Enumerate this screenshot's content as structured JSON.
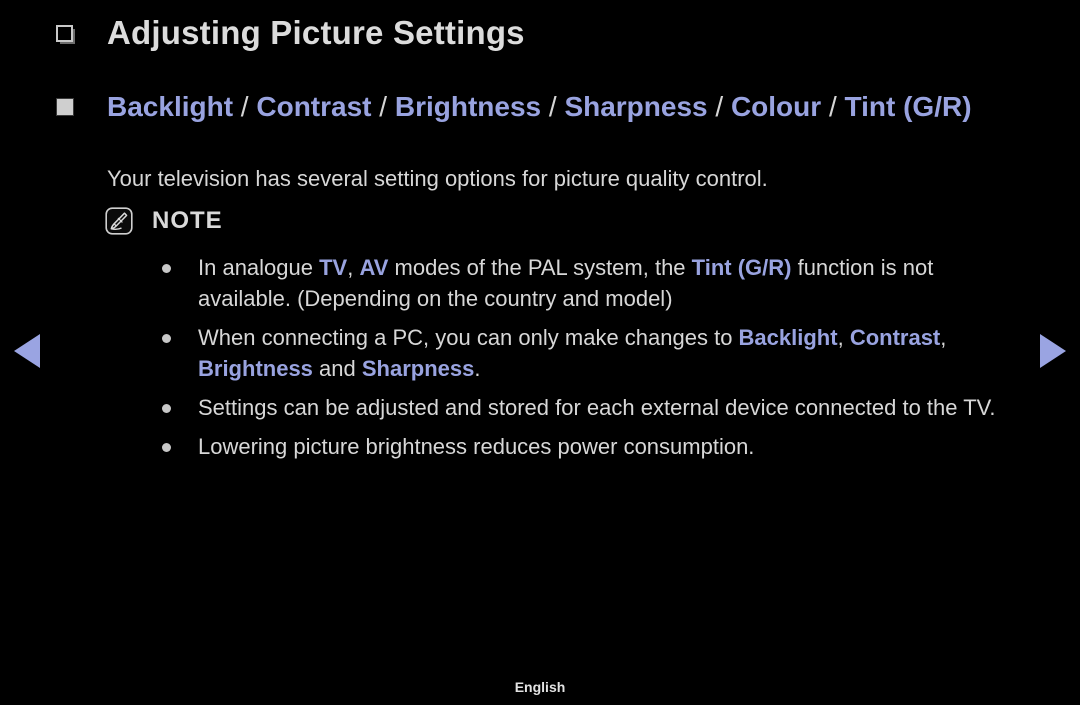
{
  "page": {
    "title": "Adjusting Picture Settings",
    "title_bullet_icon": "square-outline-icon",
    "section_bullet_icon": "filled-square-icon",
    "description": "Your television has several setting options for picture quality control.",
    "footer_language": "English"
  },
  "section_heading": {
    "segments": [
      {
        "text": "Backlight",
        "style": "term"
      },
      {
        "text": " / ",
        "style": "separator"
      },
      {
        "text": "Contrast",
        "style": "term"
      },
      {
        "text": " / ",
        "style": "separator"
      },
      {
        "text": "Brightness",
        "style": "term"
      },
      {
        "text": " / ",
        "style": "separator"
      },
      {
        "text": "Sharpness",
        "style": "term"
      },
      {
        "text": " / ",
        "style": "separator"
      },
      {
        "text": "Colour",
        "style": "term"
      },
      {
        "text": " / ",
        "style": "separator"
      },
      {
        "text": "Tint (G/R)",
        "style": "term"
      }
    ]
  },
  "note": {
    "icon": "note-pen-icon",
    "label": "NOTE",
    "items": [
      {
        "segments": [
          {
            "text": "In analogue ",
            "style": "plain"
          },
          {
            "text": "TV",
            "style": "term"
          },
          {
            "text": ", ",
            "style": "plain"
          },
          {
            "text": "AV",
            "style": "term"
          },
          {
            "text": " modes of the PAL system, the ",
            "style": "plain"
          },
          {
            "text": "Tint (G/R)",
            "style": "term"
          },
          {
            "text": " function is not available. (Depending on the country and model)",
            "style": "plain"
          }
        ]
      },
      {
        "segments": [
          {
            "text": "When connecting a PC, you can only make changes to ",
            "style": "plain"
          },
          {
            "text": "Backlight",
            "style": "term"
          },
          {
            "text": ", ",
            "style": "plain"
          },
          {
            "text": "Contrast",
            "style": "term"
          },
          {
            "text": ", ",
            "style": "plain"
          },
          {
            "text": "Brightness",
            "style": "term"
          },
          {
            "text": " and ",
            "style": "plain"
          },
          {
            "text": "Sharpness",
            "style": "term"
          },
          {
            "text": ".",
            "style": "plain"
          }
        ]
      },
      {
        "segments": [
          {
            "text": "Settings can be adjusted and stored for each external device connected to the TV.",
            "style": "plain"
          }
        ]
      },
      {
        "segments": [
          {
            "text": "Lowering picture brightness reduces power consumption.",
            "style": "plain"
          }
        ]
      }
    ]
  },
  "navigation": {
    "previous_icon": "arrow-left-icon",
    "next_icon": "arrow-right-icon"
  },
  "colors": {
    "background": "#000000",
    "body_text": "#d7d7d7",
    "accent_blue": "#99a3e0",
    "separator": "#d5d5d5"
  }
}
